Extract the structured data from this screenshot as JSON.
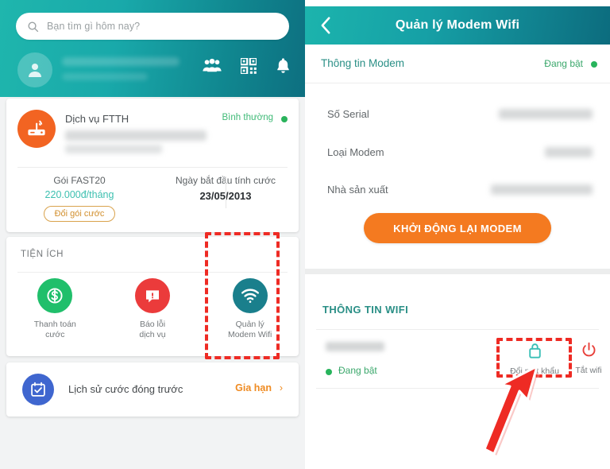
{
  "left_screen": {
    "search": {
      "placeholder": "Bạn tìm gì hôm nay?",
      "icon": "search-icon"
    },
    "header_icons": [
      "friends-icon",
      "qr-code-icon",
      "bell-icon"
    ],
    "avatar": "user-avatar-icon",
    "service": {
      "icon": "modem-router-icon",
      "title": "Dịch vụ FTTH",
      "status": "Bình thường",
      "status_color": "#3fba77"
    },
    "plan": {
      "name": "Gói FAST20",
      "price": "220.000đ/tháng",
      "change_button": "Đổi gói cước",
      "billing_label": "Ngày bắt đầu tính cước",
      "billing_date": "23/05/2013"
    },
    "utilities": {
      "section_title": "TIỆN ÍCH",
      "items": [
        {
          "label": "Thanh toán\ncước",
          "line1": "Thanh toán",
          "line2": "cước",
          "icon": "dollar-coin-icon",
          "color": "#20bf6b"
        },
        {
          "label": "Báo lỗi dịch vụ",
          "line1": "Báo lỗi",
          "line2": "dịch vụ",
          "icon": "alert-chat-icon",
          "color": "#eb3b3b"
        },
        {
          "label": "Quản lý Modem Wifi",
          "line1": "Quản lý",
          "line2": "Modem Wifi",
          "icon": "wifi-icon",
          "color": "#1a7f8c"
        }
      ]
    },
    "history": {
      "icon": "calendar-check-icon",
      "label": "Lịch sử cước đóng trước",
      "action": "Gia hạn",
      "chevron": "chevron-right-icon",
      "color": "#3f66cf"
    }
  },
  "right_screen": {
    "header": {
      "back": "chevron-left-icon",
      "title": "Quản lý Modem Wifi"
    },
    "modem_info": {
      "title": "Thông tin Modem",
      "status": "Đang bật",
      "status_color": "#3aa76b",
      "fields": [
        {
          "label": "Số Serial",
          "value": ""
        },
        {
          "label": "Loại Modem",
          "value": ""
        },
        {
          "label": "Nhà sản xuất",
          "value": ""
        }
      ]
    },
    "restart_button": "KHỞI ĐỘNG LẠI MODEM",
    "wifi": {
      "section_title": "THÔNG TIN WIFI",
      "state": "Đang bật",
      "actions": [
        {
          "label": "Đổi mật khẩu",
          "icon": "lock-icon",
          "color": "#3bbfb7"
        },
        {
          "label": "Tắt wifi",
          "icon": "power-icon",
          "color": "#e8403a"
        }
      ]
    }
  },
  "annotations": {
    "highlight_color": "#ee2b24",
    "boxes": [
      "utility-modem-wifi-highlight",
      "change-password-highlight"
    ],
    "arrow": "pointer-arrow"
  }
}
